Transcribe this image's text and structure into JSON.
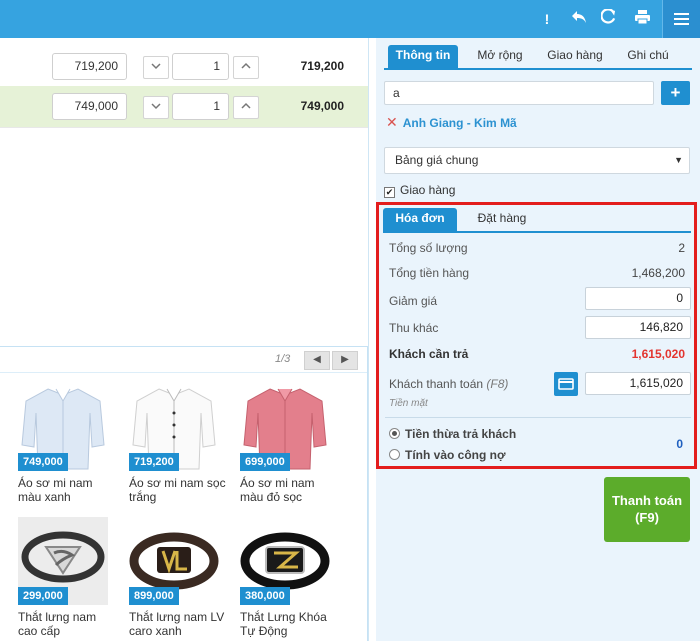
{
  "topbar": {
    "icons": [
      "exclamation-icon",
      "undo-icon",
      "refresh-icon",
      "print-icon",
      "menu-icon"
    ],
    "alert_glyph": "!"
  },
  "cart": {
    "rows": [
      {
        "price": "719,200",
        "qty": "1",
        "total": "719,200"
      },
      {
        "price": "749,000",
        "qty": "1",
        "total": "749,000"
      }
    ]
  },
  "products": {
    "page": "1/3",
    "items": [
      {
        "price": "749,000",
        "name": "Áo sơ mi nam màu xanh"
      },
      {
        "price": "719,200",
        "name": "Áo sơ mi nam sọc trắng"
      },
      {
        "price": "699,000",
        "name": "Áo sơ mi nam màu đỏ sọc"
      },
      {
        "price": "299,000",
        "name": "Thắt lưng nam cao cấp"
      },
      {
        "price": "899,000",
        "name": "Thắt lưng nam LV caro xanh"
      },
      {
        "price": "380,000",
        "name": "Thắt Lưng Khóa Tự Động"
      }
    ]
  },
  "right_panel": {
    "tabs": [
      "Thông tin",
      "Mở rộng",
      "Giao hàng",
      "Ghi chú"
    ],
    "search_value": "a",
    "add_glyph": "+",
    "customer": "Anh Giang - Kim Mã",
    "pricebook": "Bảng giá chung",
    "delivery_label": "Giao hàng"
  },
  "invoice": {
    "tabs": [
      "Hóa đơn",
      "Đặt hàng"
    ],
    "total_qty_label": "Tổng số lượng",
    "total_qty": "2",
    "subtotal_label": "Tổng tiền hàng",
    "subtotal": "1,468,200",
    "discount_label": "Giảm giá",
    "discount": "0",
    "other_fee_label": "Thu khác",
    "other_fee": "146,820",
    "due_label": "Khách cần trả",
    "due": "1,615,020",
    "paid_label": "Khách thanh toán",
    "paid_hint": "(F8)",
    "paid": "1,615,020",
    "method": "Tiền mặt",
    "change_label": "Tiền thừa trả khách",
    "change": "0",
    "debt_label": "Tính vào công nợ"
  },
  "pay_button": {
    "label": "Thanh toán",
    "shortcut": "(F9)"
  },
  "colors": {
    "accent": "#1f8fd0",
    "topbar": "#36a3e0",
    "pay": "#5cac2b",
    "due": "#e3342f",
    "highlight": "#e31d1d"
  }
}
